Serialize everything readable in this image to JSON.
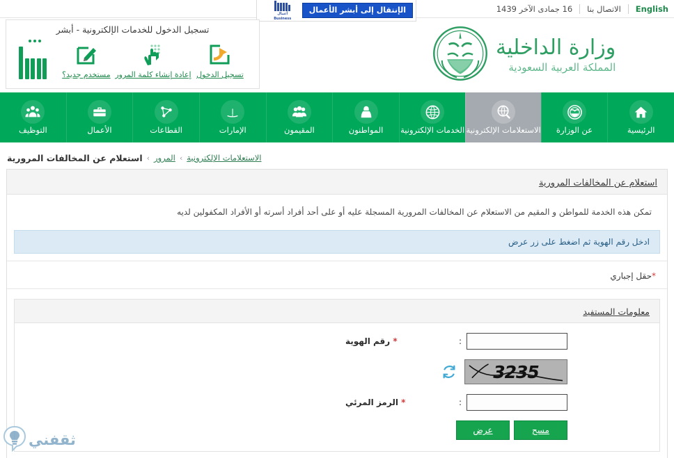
{
  "topbar": {
    "date": "16 جمادى الآخر 1439",
    "contact": "الاتصال بنا",
    "english": "English"
  },
  "business": {
    "button_label": "الإنتقال إلى أبشر الأعمال",
    "logo_line1": "أعمال",
    "logo_line2": "Business"
  },
  "login": {
    "title": "تسجيل الدخول للخدمات الإلكترونية - أبشر",
    "links": [
      {
        "label": "تسجيل الدخول",
        "icon": "login-arrow-icon"
      },
      {
        "label": "إعادة إنشاء كلمة المرور",
        "icon": "hand-keypad-icon"
      },
      {
        "label": "مستخدم جديد؟",
        "icon": "pencil-form-icon"
      }
    ],
    "logo_alt": "أبشر"
  },
  "brand": {
    "name": "وزارة الداخلية",
    "country": "المملكة العربية السعودية",
    "emblem": "saudi-moi-emblem"
  },
  "nav": {
    "active_index": 2,
    "items": [
      {
        "label": "الرئيسية",
        "icon": "home-icon"
      },
      {
        "label": "عن الوزارة",
        "icon": "moi-seal-icon"
      },
      {
        "label": "الاستعلامات الإلكترونية",
        "icon": "globe-magnifier-icon"
      },
      {
        "label": "الخدمات الإلكترونية",
        "icon": "globe-icon"
      },
      {
        "label": "المواطنون",
        "icon": "citizen-icon"
      },
      {
        "label": "المقيمون",
        "icon": "residents-group-icon"
      },
      {
        "label": "الإمارات",
        "icon": "emirates-calligraphy-icon"
      },
      {
        "label": "القطاعات",
        "icon": "sectors-network-icon"
      },
      {
        "label": "الأعمال",
        "icon": "briefcase-icon"
      },
      {
        "label": "التوظيف",
        "icon": "employment-people-icon"
      }
    ]
  },
  "breadcrumb": {
    "items": [
      "الاستعلامات الإلكترونية",
      "المرور",
      "استعلام عن المخالفات المرورية"
    ],
    "separator": "›"
  },
  "page": {
    "title": "استعلام عن المخالفات المرورية",
    "description": "تمكن هذه الخدمة للمواطن و المقيم من الاستعلام عن المخالفات المرورية المسجلة عليه أو على أحد أفراد أسرته أو الأفراد المكفولين لديه",
    "info": "ادخل رقم الهوية ثم اضغط على زر عرض",
    "required_note": "حقل إجباري",
    "required_star": "*"
  },
  "form": {
    "section_title": "معلومات المستفيد",
    "colon": ":",
    "fields": [
      {
        "label": "رقم الهوية",
        "required": "*",
        "value": "",
        "placeholder": ""
      },
      {
        "label": "الرمز المرئي",
        "required": "*",
        "value": "",
        "placeholder": ""
      }
    ],
    "captcha": {
      "text": "3235",
      "refresh_icon": "refresh-icon"
    },
    "buttons": [
      {
        "label": "عرض",
        "name": "submit-button"
      },
      {
        "label": "مسح",
        "name": "clear-button"
      }
    ]
  },
  "watermark": {
    "text": "ثقفني",
    "icon": "lightbulb-bubble-icon"
  },
  "colors": {
    "green": "#00a85a",
    "active_grey": "#a4aab0",
    "blue": "#1853c8",
    "info_bg": "#dbeaf5",
    "button_green": "#17a44f"
  }
}
